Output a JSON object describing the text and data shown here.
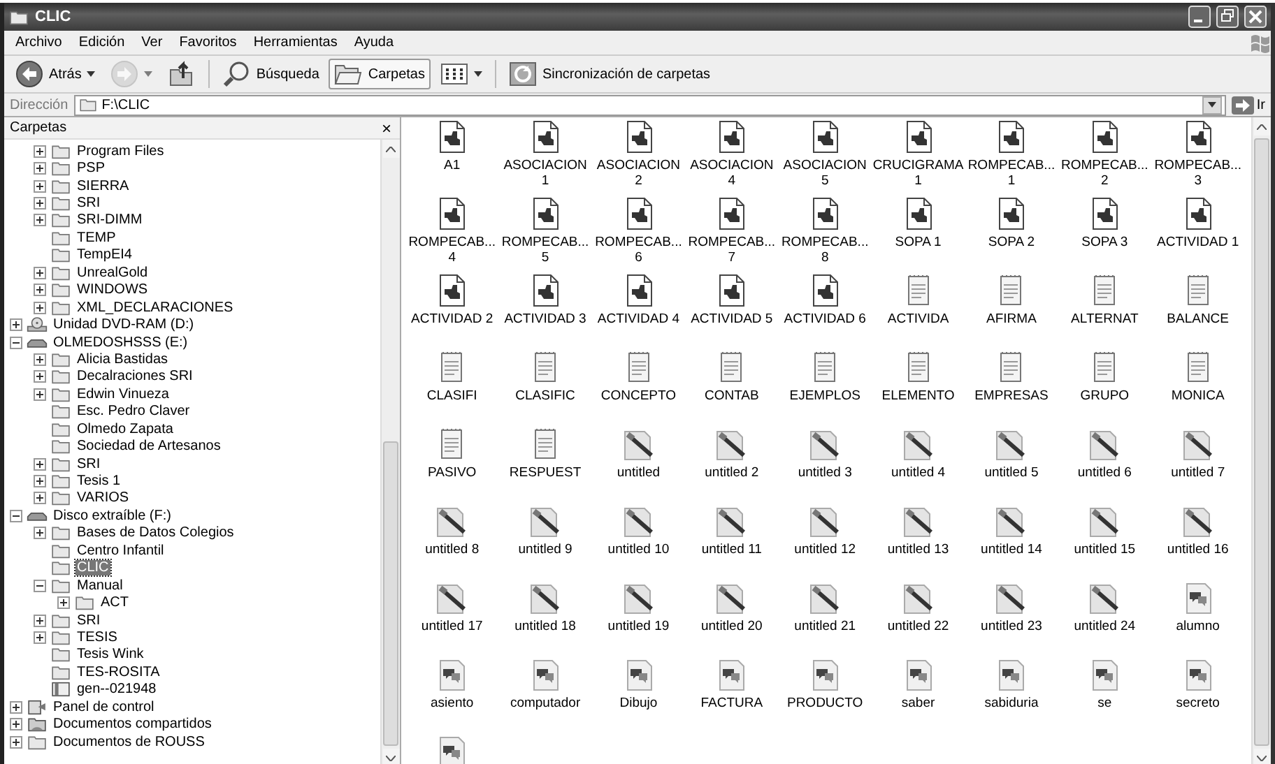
{
  "window": {
    "title": "CLIC"
  },
  "menu": [
    "Archivo",
    "Edición",
    "Ver",
    "Favoritos",
    "Herramientas",
    "Ayuda"
  ],
  "toolbar": [
    {
      "kind": "back",
      "label": "Atrás",
      "pressed": false,
      "disabled": false
    },
    {
      "kind": "forward",
      "pressed": false,
      "disabled": true
    },
    {
      "kind": "up",
      "pressed": false,
      "disabled": false
    },
    {
      "kind": "search",
      "label": "Búsqueda",
      "pressed": false,
      "disabled": false
    },
    {
      "kind": "folders",
      "label": "Carpetas",
      "pressed": true,
      "disabled": false
    },
    {
      "kind": "views",
      "pressed": false,
      "disabled": false
    },
    {
      "kind": "sync",
      "label": "Sincronización de carpetas",
      "pressed": false,
      "disabled": false
    }
  ],
  "address": {
    "label": "Dirección",
    "value": "F:\\CLIC",
    "go": "Ir"
  },
  "folders_pane": {
    "title": "Carpetas",
    "close": "×",
    "tree": [
      {
        "children": [
          {
            "label": "Program Files",
            "kind": "folder",
            "expanded": false,
            "selected": false
          },
          {
            "label": "PSP",
            "kind": "folder",
            "expanded": false,
            "selected": false
          },
          {
            "label": "SIERRA",
            "kind": "folder",
            "expanded": false,
            "selected": false
          },
          {
            "label": "SRI",
            "kind": "folder",
            "expanded": false,
            "selected": false
          },
          {
            "label": "SRI-DIMM",
            "kind": "folder",
            "expanded": false,
            "selected": false
          },
          {
            "label": "TEMP",
            "kind": "folder",
            "selected": false
          },
          {
            "label": "TempEI4",
            "kind": "folder",
            "selected": false
          },
          {
            "label": "UnrealGold",
            "kind": "folder",
            "expanded": false,
            "selected": false
          },
          {
            "label": "WINDOWS",
            "kind": "folder",
            "expanded": false,
            "selected": false
          },
          {
            "label": "XML_DECLARACIONES",
            "kind": "folder",
            "expanded": false,
            "selected": false
          }
        ]
      },
      {
        "label": "Unidad DVD-RAM (D:)",
        "kind": "dvd",
        "expanded": false,
        "selected": false
      },
      {
        "label": "OLMEDOSHSSS (E:)",
        "kind": "drive",
        "expanded": true,
        "selected": false,
        "children": [
          {
            "label": "Alicia Bastidas",
            "kind": "folder",
            "expanded": false,
            "selected": false
          },
          {
            "label": "Decalraciones SRI",
            "kind": "folder",
            "expanded": false,
            "selected": false
          },
          {
            "label": "Edwin Vinueza",
            "kind": "folder",
            "expanded": false,
            "selected": false
          },
          {
            "label": "Esc. Pedro Claver",
            "kind": "folder",
            "selected": false
          },
          {
            "label": "Olmedo Zapata",
            "kind": "folder",
            "selected": false
          },
          {
            "label": "Sociedad de Artesanos",
            "kind": "folder",
            "selected": false
          },
          {
            "label": "SRI",
            "kind": "folder",
            "expanded": false,
            "selected": false
          },
          {
            "label": "Tesis 1",
            "kind": "folder",
            "expanded": false,
            "selected": false
          },
          {
            "label": "VARIOS",
            "kind": "folder",
            "expanded": false,
            "selected": false
          }
        ]
      },
      {
        "label": "Disco extraíble (F:)",
        "kind": "drive",
        "expanded": true,
        "selected": false,
        "children": [
          {
            "label": "Bases de Datos Colegios",
            "kind": "folder",
            "expanded": false,
            "selected": false
          },
          {
            "label": "Centro Infantil",
            "kind": "folder",
            "selected": false
          },
          {
            "label": "CLIC",
            "kind": "folder",
            "selected": true
          },
          {
            "label": "Manual",
            "kind": "folder",
            "expanded": true,
            "selected": false,
            "children": [
              {
                "label": "ACT",
                "kind": "folder",
                "expanded": false,
                "selected": false
              }
            ]
          },
          {
            "label": "SRI",
            "kind": "folder",
            "expanded": false,
            "selected": false
          },
          {
            "label": "TESIS",
            "kind": "folder",
            "expanded": false,
            "selected": false
          },
          {
            "label": "Tesis  Wink",
            "kind": "folder",
            "selected": false
          },
          {
            "label": "TES-ROSITA",
            "kind": "folder",
            "selected": false
          },
          {
            "label": "gen--021948",
            "kind": "archive",
            "selected": false
          }
        ]
      },
      {
        "label": "Panel de control",
        "kind": "control-panel",
        "expanded": false,
        "selected": false
      },
      {
        "label": "Documentos compartidos",
        "kind": "shared-folder",
        "expanded": false,
        "selected": false
      },
      {
        "label": "Documentos de ROUSS",
        "kind": "folder",
        "expanded": false,
        "selected": false
      }
    ]
  },
  "files": [
    {
      "label": "A1",
      "kind": "clic"
    },
    {
      "label": "ASOCIACION\n1",
      "kind": "clic"
    },
    {
      "label": "ASOCIACION\n2",
      "kind": "clic"
    },
    {
      "label": "ASOCIACION\n4",
      "kind": "clic"
    },
    {
      "label": "ASOCIACION\n5",
      "kind": "clic"
    },
    {
      "label": "CRUCIGRAMA\n1",
      "kind": "clic"
    },
    {
      "label": "ROMPECAB...\n1",
      "kind": "clic"
    },
    {
      "label": "ROMPECAB...\n2",
      "kind": "clic"
    },
    {
      "label": "ROMPECAB...\n3",
      "kind": "clic"
    },
    {
      "label": "ROMPECAB...\n4",
      "kind": "clic"
    },
    {
      "label": "ROMPECAB...\n5",
      "kind": "clic"
    },
    {
      "label": "ROMPECAB...\n6",
      "kind": "clic"
    },
    {
      "label": "ROMPECAB...\n7",
      "kind": "clic"
    },
    {
      "label": "ROMPECAB...\n8",
      "kind": "clic"
    },
    {
      "label": "SOPA 1",
      "kind": "clic"
    },
    {
      "label": "SOPA 2",
      "kind": "clic"
    },
    {
      "label": "SOPA 3",
      "kind": "clic"
    },
    {
      "label": "ACTIVIDAD 1",
      "kind": "clic"
    },
    {
      "label": "ACTIVIDAD 2",
      "kind": "clic"
    },
    {
      "label": "ACTIVIDAD 3",
      "kind": "clic"
    },
    {
      "label": "ACTIVIDAD 4",
      "kind": "clic"
    },
    {
      "label": "ACTIVIDAD 5",
      "kind": "clic"
    },
    {
      "label": "ACTIVIDAD 6",
      "kind": "clic"
    },
    {
      "label": "ACTIVIDA",
      "kind": "notepad"
    },
    {
      "label": "AFIRMA",
      "kind": "notepad"
    },
    {
      "label": "ALTERNAT",
      "kind": "notepad"
    },
    {
      "label": "BALANCE",
      "kind": "notepad"
    },
    {
      "label": "CLASIFI",
      "kind": "notepad"
    },
    {
      "label": "CLASIFIC",
      "kind": "notepad"
    },
    {
      "label": "CONCEPTO",
      "kind": "notepad"
    },
    {
      "label": "CONTAB",
      "kind": "notepad"
    },
    {
      "label": "EJEMPLOS",
      "kind": "notepad"
    },
    {
      "label": "ELEMENTO",
      "kind": "notepad"
    },
    {
      "label": "EMPRESAS",
      "kind": "notepad"
    },
    {
      "label": "GRUPO",
      "kind": "notepad"
    },
    {
      "label": "MONICA",
      "kind": "notepad"
    },
    {
      "label": "PASIVO",
      "kind": "notepad"
    },
    {
      "label": "RESPUEST",
      "kind": "notepad"
    },
    {
      "label": "untitled",
      "kind": "paint"
    },
    {
      "label": "untitled 2",
      "kind": "paint"
    },
    {
      "label": "untitled 3",
      "kind": "paint"
    },
    {
      "label": "untitled 4",
      "kind": "paint"
    },
    {
      "label": "untitled 5",
      "kind": "paint"
    },
    {
      "label": "untitled 6",
      "kind": "paint"
    },
    {
      "label": "untitled 7",
      "kind": "paint"
    },
    {
      "label": "untitled 8",
      "kind": "paint"
    },
    {
      "label": "untitled 9",
      "kind": "paint"
    },
    {
      "label": "untitled 10",
      "kind": "paint"
    },
    {
      "label": "untitled 11",
      "kind": "paint"
    },
    {
      "label": "untitled 12",
      "kind": "paint"
    },
    {
      "label": "untitled 13",
      "kind": "paint"
    },
    {
      "label": "untitled 14",
      "kind": "paint"
    },
    {
      "label": "untitled 15",
      "kind": "paint"
    },
    {
      "label": "untitled 16",
      "kind": "paint"
    },
    {
      "label": "untitled 17",
      "kind": "paint"
    },
    {
      "label": "untitled 18",
      "kind": "paint"
    },
    {
      "label": "untitled 19",
      "kind": "paint"
    },
    {
      "label": "untitled 20",
      "kind": "paint"
    },
    {
      "label": "untitled 21",
      "kind": "paint"
    },
    {
      "label": "untitled 22",
      "kind": "paint"
    },
    {
      "label": "untitled 23",
      "kind": "paint"
    },
    {
      "label": "untitled 24",
      "kind": "paint"
    },
    {
      "label": "alumno",
      "kind": "chat"
    },
    {
      "label": "asiento",
      "kind": "chat"
    },
    {
      "label": "computador",
      "kind": "chat"
    },
    {
      "label": "Dibujo",
      "kind": "chat"
    },
    {
      "label": "FACTURA",
      "kind": "chat"
    },
    {
      "label": "PRODUCTO",
      "kind": "chat"
    },
    {
      "label": "saber",
      "kind": "chat"
    },
    {
      "label": "sabiduria",
      "kind": "chat"
    },
    {
      "label": "se",
      "kind": "chat"
    },
    {
      "label": "secreto",
      "kind": "chat"
    },
    {
      "kind": "chat"
    }
  ]
}
